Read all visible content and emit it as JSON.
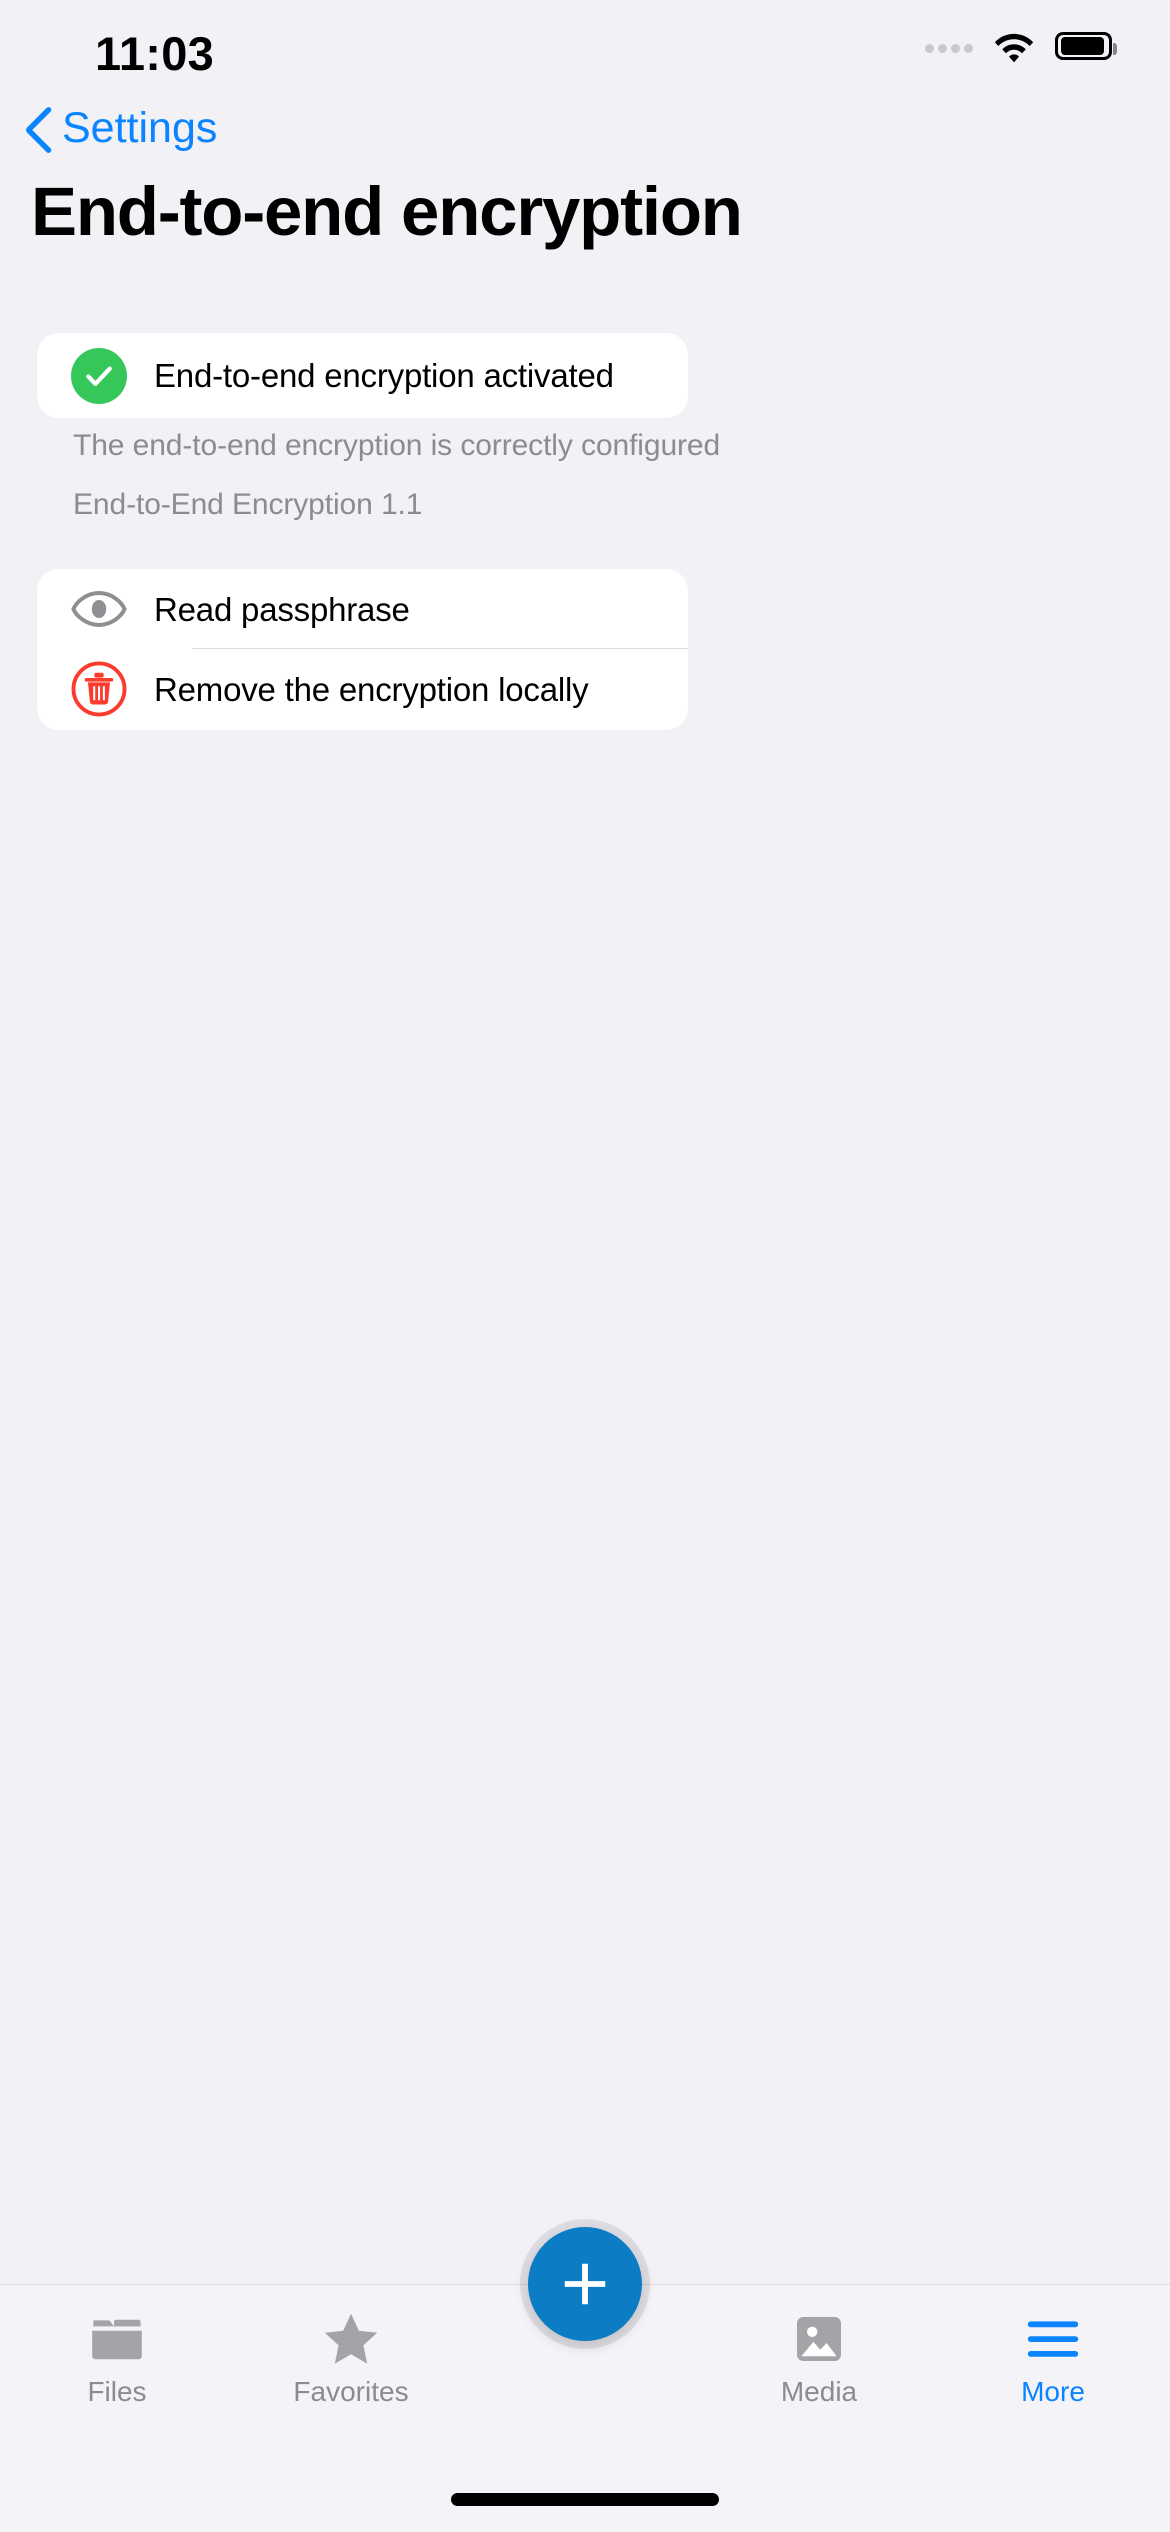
{
  "status_bar": {
    "time": "11:03",
    "cellular_icon": "cellular-dots-icon",
    "wifi_icon": "wifi-icon",
    "battery_icon": "battery-icon"
  },
  "navigation": {
    "back_label": "Settings",
    "back_icon": "chevron-left-icon"
  },
  "page_title": "End-to-end encryption",
  "status_card": {
    "icon": "green-check-circle-icon",
    "label": "End-to-end encryption activated",
    "accent_color": "#35C759"
  },
  "footnotes": {
    "configured": "The end-to-end encryption is correctly configured",
    "version": "End-to-End Encryption 1.1"
  },
  "action_rows": [
    {
      "icon": "eye-icon",
      "label": "Read passphrase",
      "icon_color": "#8B8B91"
    },
    {
      "icon": "trash-circle-icon",
      "label": "Remove the encryption locally",
      "icon_color": "#FA3B2E"
    }
  ],
  "tab_bar": {
    "tabs": [
      {
        "label": "Files",
        "icon": "folder-icon",
        "active": false
      },
      {
        "label": "Favorites",
        "icon": "star-icon",
        "active": false
      },
      {
        "label": "Media",
        "icon": "photo-icon",
        "active": false
      },
      {
        "label": "More",
        "icon": "hamburger-menu-icon",
        "active": true
      }
    ],
    "fab": {
      "icon": "plus-icon",
      "color": "#0C7DC4"
    },
    "active_color": "#0A84FF",
    "inactive_color": "#8B8B91"
  }
}
